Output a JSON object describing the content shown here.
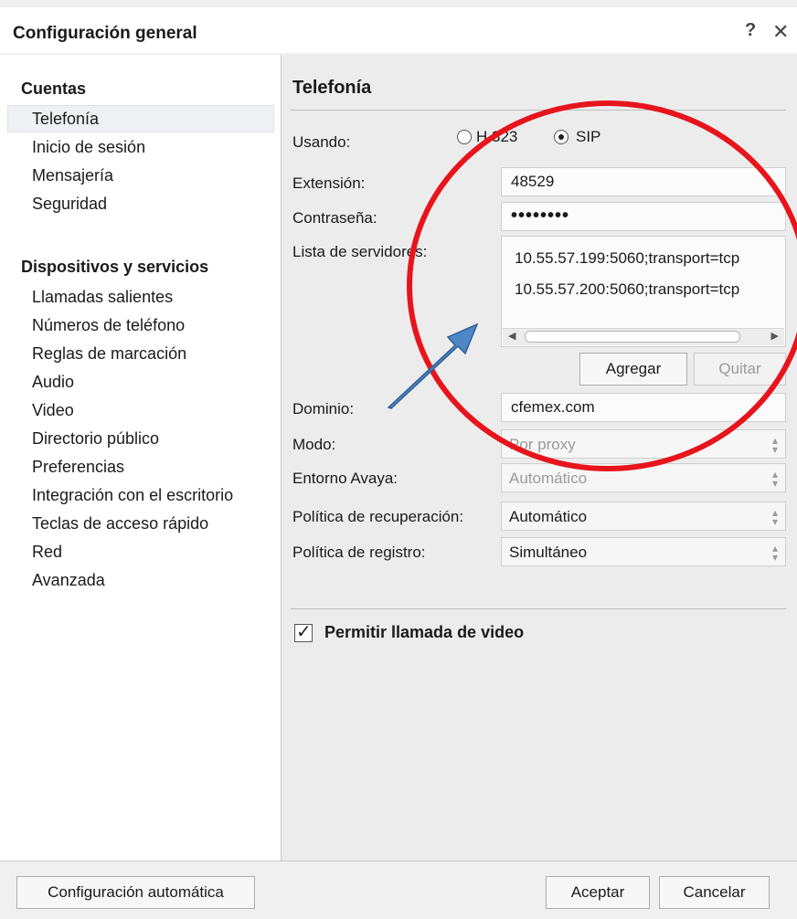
{
  "window": {
    "title": "Configuración general",
    "help_label": "?",
    "close_label": "✕"
  },
  "sidebar": {
    "sections": [
      {
        "title": "Cuentas",
        "items": [
          "Telefonía",
          "Inicio de sesión",
          "Mensajería",
          "Seguridad"
        ]
      },
      {
        "title": "Dispositivos y servicios",
        "items": [
          "Llamadas salientes",
          "Números de teléfono",
          "Reglas de marcación",
          "Audio",
          "Video",
          "Directorio público",
          "Preferencias",
          "Integración con el escritorio",
          "Teclas de acceso rápido",
          "Red",
          "Avanzada"
        ]
      }
    ],
    "selected_item": "Telefonía"
  },
  "panel": {
    "title": "Telefonía",
    "usando_label": "Usando:",
    "radio_options": [
      {
        "label": "H.323",
        "selected": false
      },
      {
        "label": "SIP",
        "selected": true
      }
    ],
    "extension_label": "Extensión:",
    "extension_value": "48529",
    "password_label": "Contraseña:",
    "password_value": "••••••••",
    "server_list_label": "Lista de servidores:",
    "servers": [
      "10.55.57.199:5060;transport=tcp",
      "10.55.57.200:5060;transport=tcp"
    ],
    "add_button": "Agregar",
    "remove_button": "Quitar",
    "domain_label": "Dominio:",
    "domain_value": "cfemex.com",
    "mode_label": "Modo:",
    "mode_value": "Por proxy",
    "environment_label": "Entorno Avaya:",
    "environment_value": "Automático",
    "recovery_label": "Política de recuperación:",
    "recovery_value": "Automático",
    "registration_label": "Política de registro:",
    "registration_value": "Simultáneo",
    "video_checkbox_label": "Permitir llamada de video",
    "video_checkbox_checked": true
  },
  "footer": {
    "auto_config_button": "Configuración automática",
    "accept_button": "Aceptar",
    "cancel_button": "Cancelar"
  },
  "colors": {
    "annotation_circle": "#e8141c",
    "annotation_arrow": "#4f86c6",
    "selection_background": "#eef0f3"
  }
}
